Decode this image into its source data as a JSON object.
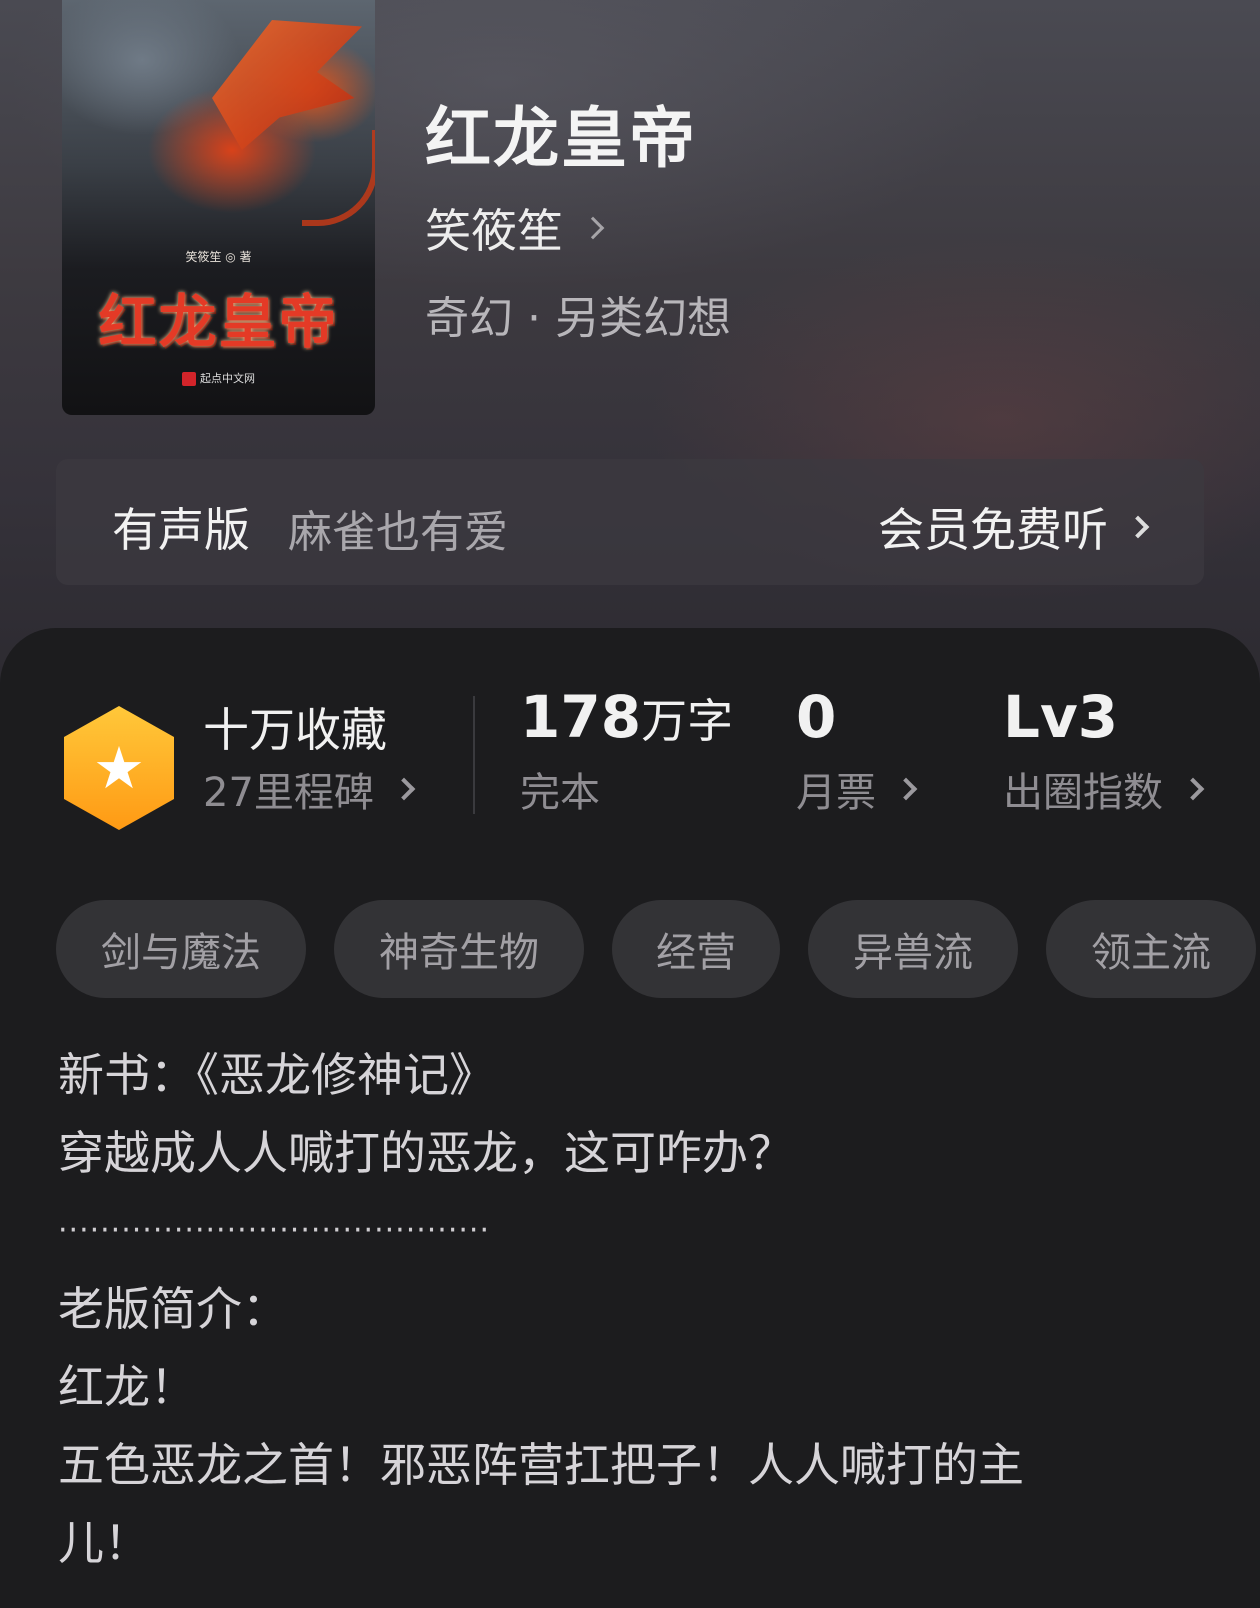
{
  "book": {
    "title": "红龙皇帝",
    "author": "笑筱笙",
    "genre": "奇幻 · 另类幻想",
    "cover": {
      "author_line": "笑筱笙 ◎ 著",
      "title": "红龙皇帝",
      "publisher": "起点中文网"
    }
  },
  "audio": {
    "label": "有声版",
    "narrator": "麻雀也有爱",
    "action": "会员免费听"
  },
  "stats": {
    "collect": {
      "main": "十万收藏",
      "sub": "27里程碑"
    },
    "words": {
      "num": "178",
      "unit": "万字",
      "sub": "完本"
    },
    "monthly": {
      "num": "0",
      "sub": "月票"
    },
    "index": {
      "num": "Lv3",
      "sub": "出圈指数"
    }
  },
  "tags": [
    "剑与魔法",
    "神奇生物",
    "经营",
    "异兽流",
    "领主流"
  ],
  "description": {
    "lines": [
      "新书：《恶龙修神记》",
      "穿越成人人喊打的恶龙，这可咋办？",
      "·········································",
      "老版简介：",
      "红龙！",
      "五色恶龙之首！邪恶阵营扛把子！人人喊打的主",
      "儿！"
    ]
  },
  "colors": {
    "badge_gradient": [
      "#ffc83a",
      "#ff9a14"
    ],
    "panel_bg": "#1c1c1e",
    "tag_bg": "#333336"
  }
}
